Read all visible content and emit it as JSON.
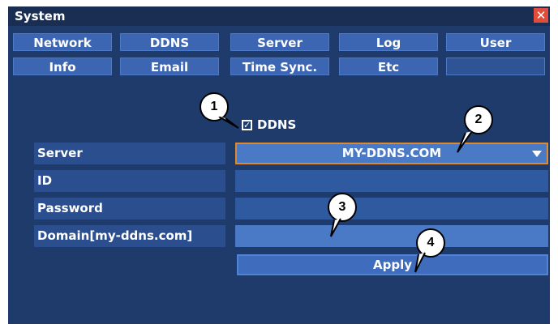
{
  "window": {
    "title": "System",
    "close_glyph": "✕",
    "tabs_row1": [
      "Network",
      "DDNS",
      "Server",
      "Log",
      "User"
    ],
    "tabs_row2": [
      "Info",
      "Email",
      "Time Sync.",
      "Etc",
      ""
    ]
  },
  "ddns": {
    "checkbox_label": "DDNS",
    "check_glyph": "✓",
    "checked": true,
    "server_label": "Server",
    "server_value": "MY-DDNS.COM",
    "id_label": "ID",
    "id_value": "",
    "password_label": "Password",
    "password_value": "",
    "domain_label": "Domain[my-ddns.com]",
    "domain_value": "",
    "apply_label": "Apply"
  },
  "callouts": [
    "1",
    "2",
    "3",
    "4"
  ],
  "colors": {
    "window_bg": "#1e3b6c",
    "tab": "#3c66b2",
    "focus_border": "#e08a2a"
  }
}
